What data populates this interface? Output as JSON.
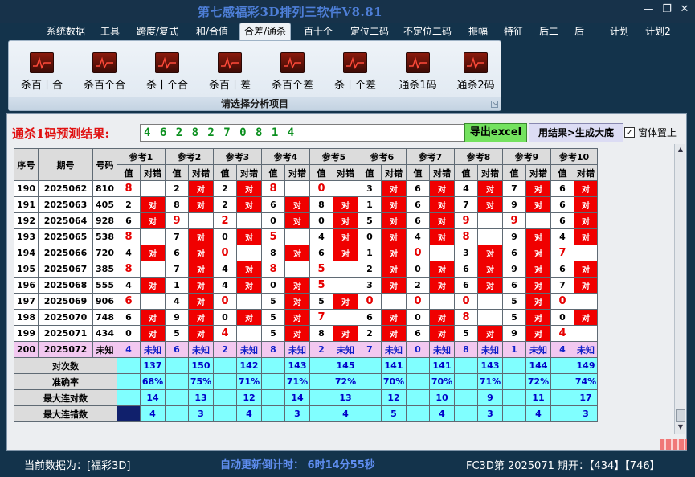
{
  "window": {
    "title": "第七感福彩3D排列三软件V8.81",
    "min_label": "—",
    "max_label": "❐",
    "close_label": "✕"
  },
  "menu": [
    "系统数据",
    "工具",
    "跨度/复式",
    "和/合值",
    "合差/通杀",
    "百十个",
    "定位二码",
    "不定位二码",
    "振幅",
    "特征",
    "后二",
    "后一",
    "计划",
    "计划2"
  ],
  "menu_active_index": 4,
  "ribbon": {
    "items": [
      "杀百十合",
      "杀百个合",
      "杀十个合",
      "杀百十差",
      "杀百个差",
      "杀十个差",
      "通杀1码",
      "通杀2码"
    ],
    "caption": "请选择分析项目",
    "corner": "↘"
  },
  "result": {
    "label": "通杀1码预测结果:",
    "value": "4 6 2 8 2 7 0 8 1 4"
  },
  "buttons": {
    "export": "导出excel",
    "generate": "用结果>生成大底"
  },
  "topmost": {
    "label": "窗体置上",
    "checked": true,
    "mark": "✓"
  },
  "table": {
    "headers": {
      "seq": "序号",
      "period": "期号",
      "number": "号码",
      "value": "值",
      "hit": "对错"
    },
    "refs": [
      "参考1",
      "参考2",
      "参考3",
      "参考4",
      "参考5",
      "参考6",
      "参考7",
      "参考8",
      "参考9",
      "参考10"
    ],
    "hit_text": "对",
    "unknown_text": "未知",
    "rows": [
      {
        "seq": "190",
        "period": "2025062",
        "number": "810",
        "vals": [
          "8",
          "2",
          "2",
          "8",
          "0",
          "3",
          "6",
          "4",
          "7",
          "6"
        ],
        "hit": [
          0,
          1,
          1,
          0,
          0,
          1,
          1,
          1,
          1,
          1
        ],
        "red": [
          1,
          0,
          0,
          1,
          1,
          0,
          0,
          0,
          0,
          0
        ]
      },
      {
        "seq": "191",
        "period": "2025063",
        "number": "405",
        "vals": [
          "2",
          "8",
          "2",
          "6",
          "8",
          "1",
          "6",
          "7",
          "9",
          "6"
        ],
        "hit": [
          1,
          1,
          1,
          1,
          1,
          1,
          1,
          1,
          1,
          1
        ],
        "red": [
          0,
          0,
          0,
          0,
          0,
          0,
          0,
          0,
          0,
          0
        ]
      },
      {
        "seq": "192",
        "period": "2025064",
        "number": "928",
        "vals": [
          "6",
          "9",
          "2",
          "0",
          "0",
          "5",
          "6",
          "9",
          "9",
          "6"
        ],
        "hit": [
          1,
          0,
          0,
          1,
          1,
          1,
          1,
          0,
          0,
          1
        ],
        "red": [
          0,
          1,
          1,
          0,
          0,
          0,
          0,
          1,
          1,
          0
        ]
      },
      {
        "seq": "193",
        "period": "2025065",
        "number": "538",
        "vals": [
          "8",
          "7",
          "0",
          "5",
          "4",
          "0",
          "4",
          "8",
          "9",
          "4"
        ],
        "hit": [
          0,
          1,
          1,
          0,
          1,
          1,
          1,
          0,
          1,
          1
        ],
        "red": [
          1,
          0,
          0,
          1,
          0,
          0,
          0,
          1,
          0,
          0
        ]
      },
      {
        "seq": "194",
        "period": "2025066",
        "number": "720",
        "vals": [
          "4",
          "6",
          "0",
          "8",
          "6",
          "1",
          "0",
          "3",
          "6",
          "7"
        ],
        "hit": [
          1,
          1,
          0,
          1,
          1,
          1,
          0,
          1,
          1,
          0
        ],
        "red": [
          0,
          0,
          1,
          0,
          0,
          0,
          1,
          0,
          0,
          1
        ]
      },
      {
        "seq": "195",
        "period": "2025067",
        "number": "385",
        "vals": [
          "8",
          "7",
          "4",
          "8",
          "5",
          "2",
          "0",
          "6",
          "9",
          "6"
        ],
        "hit": [
          0,
          1,
          1,
          0,
          0,
          1,
          1,
          1,
          1,
          1
        ],
        "red": [
          1,
          0,
          0,
          1,
          1,
          0,
          0,
          0,
          0,
          0
        ]
      },
      {
        "seq": "196",
        "period": "2025068",
        "number": "555",
        "vals": [
          "4",
          "1",
          "4",
          "0",
          "5",
          "3",
          "2",
          "6",
          "6",
          "7"
        ],
        "hit": [
          1,
          1,
          1,
          1,
          0,
          1,
          1,
          1,
          1,
          1
        ],
        "red": [
          0,
          0,
          0,
          0,
          1,
          0,
          0,
          0,
          0,
          0
        ]
      },
      {
        "seq": "197",
        "period": "2025069",
        "number": "906",
        "vals": [
          "6",
          "4",
          "0",
          "5",
          "5",
          "0",
          "0",
          "0",
          "5",
          "0"
        ],
        "hit": [
          0,
          1,
          0,
          1,
          1,
          0,
          0,
          0,
          1,
          0
        ],
        "red": [
          1,
          0,
          1,
          0,
          0,
          1,
          1,
          1,
          0,
          1
        ]
      },
      {
        "seq": "198",
        "period": "2025070",
        "number": "748",
        "vals": [
          "6",
          "9",
          "0",
          "5",
          "7",
          "6",
          "0",
          "8",
          "5",
          "0"
        ],
        "hit": [
          1,
          1,
          1,
          1,
          0,
          1,
          1,
          0,
          1,
          1
        ],
        "red": [
          0,
          0,
          0,
          0,
          1,
          0,
          0,
          1,
          0,
          0
        ]
      },
      {
        "seq": "199",
        "period": "2025071",
        "number": "434",
        "vals": [
          "0",
          "5",
          "4",
          "5",
          "8",
          "2",
          "6",
          "5",
          "9",
          "4"
        ],
        "hit": [
          1,
          1,
          0,
          1,
          1,
          1,
          1,
          1,
          1,
          0
        ],
        "red": [
          0,
          0,
          1,
          0,
          0,
          0,
          0,
          0,
          0,
          1
        ]
      }
    ],
    "predict_row": {
      "seq": "200",
      "period": "2025072",
      "number": "未知",
      "vals": [
        "4",
        "6",
        "2",
        "8",
        "2",
        "7",
        "0",
        "8",
        "1",
        "4"
      ]
    },
    "stats": [
      {
        "label": "对次数",
        "vals": [
          "137",
          "150",
          "142",
          "143",
          "145",
          "141",
          "141",
          "143",
          "144",
          "149"
        ]
      },
      {
        "label": "准确率",
        "vals": [
          "68%",
          "75%",
          "71%",
          "71%",
          "72%",
          "70%",
          "70%",
          "71%",
          "72%",
          "74%"
        ]
      },
      {
        "label": "最大连对数",
        "vals": [
          "14",
          "13",
          "12",
          "14",
          "13",
          "12",
          "10",
          "9",
          "11",
          "17"
        ]
      },
      {
        "label": "最大连错数",
        "vals": [
          "4",
          "3",
          "4",
          "3",
          "4",
          "5",
          "4",
          "3",
          "4",
          "3"
        ]
      }
    ]
  },
  "status": {
    "left": "当前数据为：[福彩3D]",
    "mid": "自动更新倒计时：  6时14分55秒",
    "right": "FC3D第 2025071 期开：【434】【746】"
  }
}
